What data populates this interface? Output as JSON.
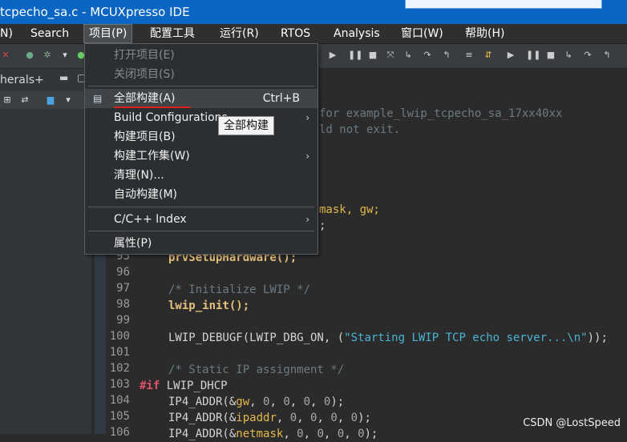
{
  "window": {
    "title": "tcpecho_sa.c - MCUXpresso IDE"
  },
  "menubar": {
    "items": [
      "N)",
      "Search",
      "项目(P)",
      "配置工具",
      "运行(R)",
      "RTOS",
      "Analysis",
      "窗口(W)",
      "帮助(H)"
    ],
    "open_index": 2
  },
  "left_panel": {
    "tab_label": "herals+"
  },
  "project_menu": {
    "items": [
      {
        "label": "打开项目(E)",
        "enabled": false
      },
      {
        "label": "关闭项目(S)",
        "enabled": false
      },
      {
        "label": "全部构建(A)",
        "accelerator": "Ctrl+B",
        "highlighted": true
      },
      {
        "label": "Build Configurations",
        "submenu": true
      },
      {
        "label": "构建项目(B)"
      },
      {
        "label": "构建工作集(W)",
        "submenu": true
      },
      {
        "label": "清理(N)..."
      },
      {
        "label": "自动构建(M)"
      },
      {
        "label": "C/C++ Index",
        "submenu": true
      },
      {
        "label": "属性(P)"
      }
    ],
    "tooltip": "全部构建"
  },
  "editor": {
    "partial_lines": [
      "for example_lwip_tcpecho_sa_17xx40xx",
      "ld not exit.",
      "mask, gw;",
      ";"
    ],
    "lines": [
      {
        "num": "95",
        "code": "prvSetupHardware();"
      },
      {
        "num": "96",
        "code": ""
      },
      {
        "num": "97",
        "code": "/* Initialize LWIP */"
      },
      {
        "num": "98",
        "code": "lwip_init();"
      },
      {
        "num": "99",
        "code": ""
      },
      {
        "num": "100",
        "code": "LWIP_DEBUGF(LWIP_DBG_ON, (\"Starting LWIP TCP echo server...\\n\"));"
      },
      {
        "num": "101",
        "code": ""
      },
      {
        "num": "102",
        "code": "/* Static IP assignment */"
      },
      {
        "num": "103",
        "code": "#if LWIP_DHCP"
      },
      {
        "num": "104",
        "code": "IP4_ADDR(&gw, 0, 0, 0, 0);"
      },
      {
        "num": "105",
        "code": "IP4_ADDR(&ipaddr, 0, 0, 0, 0);"
      },
      {
        "num": "106",
        "code": "IP4_ADDR(&netmask, 0, 0, 0, 0);"
      }
    ]
  },
  "watermark": "CSDN @LostSpeed",
  "colors": {
    "titlebar": "#0b66c3",
    "comment": "#6b7a83",
    "keyword": "#e0526a",
    "function": "#e6c07b",
    "string": "#49b4d4",
    "variable": "#e4b84d",
    "underline": "#e02020"
  },
  "icons": [
    "toolbar-run-icon",
    "toolbar-debug-icon",
    "toolbar-step-icon",
    "menu-build-icon",
    "submenu-arrow-icon"
  ]
}
